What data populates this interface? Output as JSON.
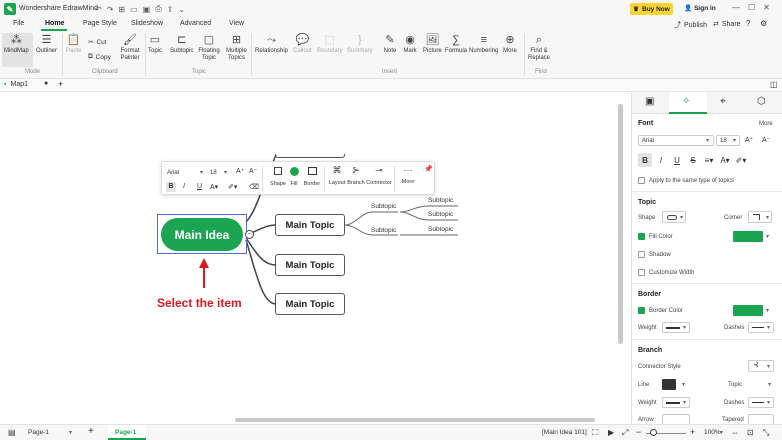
{
  "app": {
    "title": "Wondershare EdrawMind",
    "buy_label": "Buy Now",
    "signin_label": "Sign in",
    "publish_label": "Publish",
    "share_label": "Share"
  },
  "menu": {
    "tabs": [
      "File",
      "Home",
      "Page Style",
      "Slideshow",
      "Advanced",
      "View"
    ],
    "active": "Home"
  },
  "ribbon": {
    "mode": {
      "group": "Mode",
      "items": [
        "MindMap",
        "Outliner"
      ]
    },
    "clipboard": {
      "group": "Clipboard",
      "paste": "Paste",
      "cut": "Cut",
      "copy": "Copy",
      "format_painter": "Format Painter"
    },
    "topic": {
      "group": "Topic",
      "items": [
        "Topic",
        "Subtopic",
        "Floating Topic",
        "Multiple Topics"
      ]
    },
    "insert": {
      "group": "Insert",
      "items": [
        "Relationship",
        "Callout",
        "Boundary",
        "Summary",
        "Note",
        "Mark",
        "Picture",
        "Formula",
        "Numbering",
        "More"
      ]
    },
    "find": {
      "group": "Find",
      "label": "Find & Replace"
    }
  },
  "doc_tab": {
    "name": "Map1"
  },
  "canvas": {
    "main_idea": "Main Idea",
    "topics": [
      "Main Topic",
      "Main Topic",
      "Main Topic"
    ],
    "subtopics": [
      "Subtopic",
      "Subtopic",
      "Subtopic",
      "Subtopic"
    ],
    "annotation": "Select the item",
    "floatbar": {
      "font": "Arial",
      "size": "18",
      "labels": [
        "Shape",
        "Fill",
        "Border",
        "Layout",
        "Branch",
        "Connector",
        "More"
      ]
    }
  },
  "panel": {
    "font": {
      "title": "Font",
      "more": "More",
      "family": "Arial",
      "size": "18",
      "apply_same": "Apply to the same type of topics"
    },
    "topic": {
      "title": "Topic",
      "shape": "Shape",
      "corner": "Corner",
      "fill_color": "Fill Color",
      "shadow": "Shadow",
      "customize_width": "Customize Width"
    },
    "border": {
      "title": "Border",
      "border_color": "Border Color",
      "weight": "Weight",
      "dashes": "Dashes"
    },
    "branch": {
      "title": "Branch",
      "connector_style": "Connector Style",
      "line": "Line",
      "topic": "Topic",
      "weight": "Weight",
      "dashes": "Dashes",
      "arrow": "Arrow",
      "tapered": "Tapered"
    }
  },
  "colors": {
    "accent": "#1ba551",
    "annotation": "#d8191e",
    "logo": "#1ba551"
  },
  "status": {
    "page_selector": "Page-1",
    "active_page": "Page-1",
    "selection": "[Main Idea 101]",
    "zoom": "100%"
  }
}
